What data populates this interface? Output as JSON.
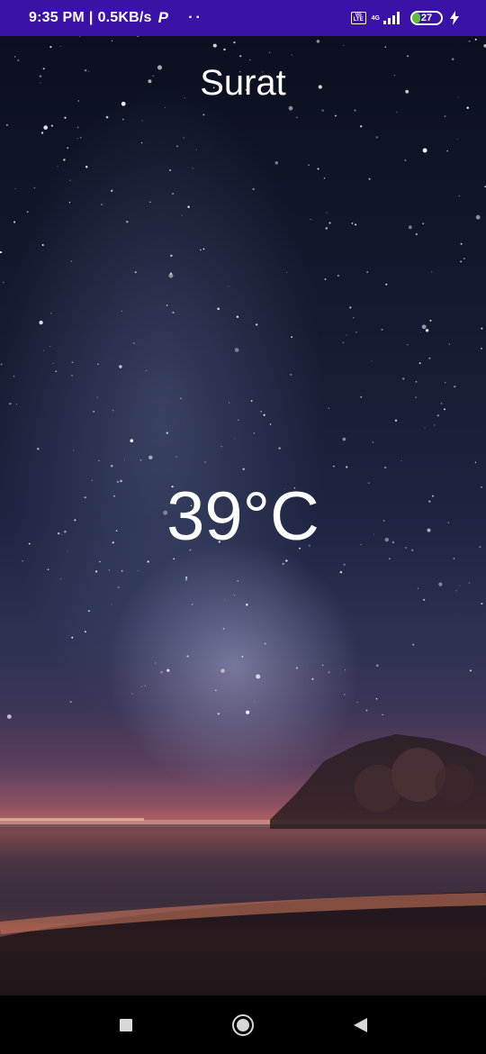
{
  "status_bar": {
    "time": "9:35 PM",
    "separator": "|",
    "speed": "0.5KB/s",
    "app_icon": "paytm-p-icon",
    "overflow": "··",
    "volte": "Vo LTE",
    "network": "4G",
    "battery_percent": 27,
    "battery_label": "27",
    "charging": true,
    "background_color": "#3a12a7"
  },
  "weather": {
    "city": "Surat",
    "temperature": "39°C"
  },
  "nav_bar": {
    "items": [
      "recents-icon",
      "home-icon",
      "back-icon"
    ]
  }
}
